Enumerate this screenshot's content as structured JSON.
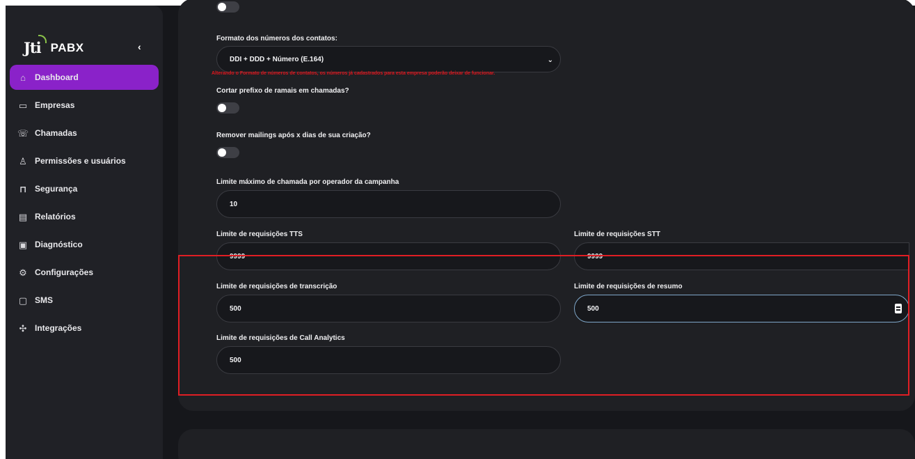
{
  "sidebar": {
    "logo_mark": "Jti",
    "logo_text": "PABX",
    "collapse_glyph": "‹",
    "items": [
      {
        "label": "Dashboard",
        "icon": "home-icon",
        "glyph": "⌂",
        "active": true
      },
      {
        "label": "Empresas",
        "icon": "briefcase-icon",
        "glyph": "▭",
        "active": false
      },
      {
        "label": "Chamadas",
        "icon": "phone-icon",
        "glyph": "☏",
        "active": false
      },
      {
        "label": "Permissões e usuários",
        "icon": "user-icon",
        "glyph": "♙",
        "active": false
      },
      {
        "label": "Segurança",
        "icon": "lock-icon",
        "glyph": "⊓",
        "active": false
      },
      {
        "label": "Relatórios",
        "icon": "document-icon",
        "glyph": "▤",
        "active": false
      },
      {
        "label": "Diagnóstico",
        "icon": "monitor-icon",
        "glyph": "▣",
        "active": false
      },
      {
        "label": "Configurações",
        "icon": "gear-icon",
        "glyph": "⚙",
        "active": false
      },
      {
        "label": "SMS",
        "icon": "message-icon",
        "glyph": "▢",
        "active": false
      },
      {
        "label": "Integrações",
        "icon": "puzzle-icon",
        "glyph": "✣",
        "active": false
      }
    ]
  },
  "form": {
    "number_format_label": "Formato dos números dos contatos:",
    "number_format_value": "DDI + DDD + Número (E.164)",
    "number_format_warning": "Alterando o Formato de números de contatos, os números já cadastrados para esta empresa poderão deixar de funcionar.",
    "cut_prefix_label": "Cortar prefixo de ramais em chamadas?",
    "remove_mailings_label": "Remover mailings após x dias de sua criação?",
    "max_calls_label": "Limite máximo de chamada por operador da campanha",
    "max_calls_value": "10",
    "tts_label": "Limite de requisições TTS",
    "tts_value": "9999",
    "stt_label": "Limite de requisições STT",
    "stt_value": "9999",
    "transcription_label": "Limite de requisições de transcrição",
    "transcription_value": "500",
    "summary_label": "Limite de requisições de resumo",
    "summary_value": "500",
    "call_analytics_label": "Limite de requisições de Call Analytics",
    "call_analytics_value": "500"
  },
  "colors": {
    "accent": "#8a22c9",
    "warning": "#e0161d",
    "highlight": "#e01e24"
  }
}
